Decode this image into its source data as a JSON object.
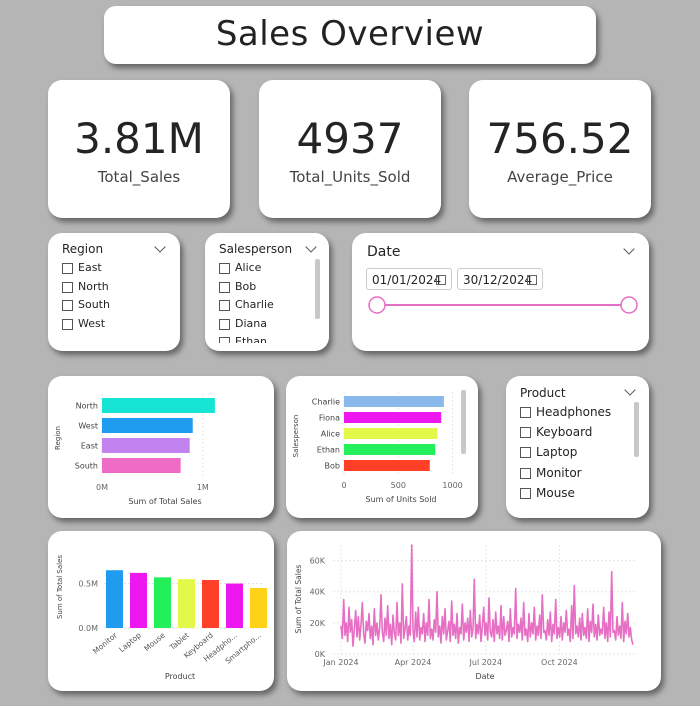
{
  "title": "Sales Overview",
  "kpis": [
    {
      "value": "3.81M",
      "label": "Total_Sales"
    },
    {
      "value": "4937",
      "label": "Total_Units_Sold"
    },
    {
      "value": "756.52",
      "label": "Average_Price"
    }
  ],
  "region_slicer": {
    "title": "Region",
    "items": [
      "East",
      "North",
      "South",
      "West"
    ]
  },
  "salesperson_slicer": {
    "title": "Salesperson",
    "items": [
      "Alice",
      "Bob",
      "Charlie",
      "Diana",
      "Ethan"
    ]
  },
  "date_slicer": {
    "title": "Date",
    "start": "01/01/2024",
    "end": "30/12/2024"
  },
  "product_slicer": {
    "title": "Product",
    "items": [
      "Headphones",
      "Keyboard",
      "Laptop",
      "Monitor",
      "Mouse"
    ]
  },
  "colors": {
    "background": "#b5b5b5",
    "slider": "#e66ec3"
  },
  "chart_data": [
    {
      "type": "bar",
      "orientation": "horizontal",
      "categories": [
        "North",
        "West",
        "East",
        "South"
      ],
      "values": [
        1.12,
        0.9,
        0.87,
        0.78
      ],
      "units": "M",
      "colors": [
        "#16e5d6",
        "#1f9bf0",
        "#c383ef",
        "#ee6cc5"
      ],
      "xlabel": "Sum of Total Sales",
      "ylabel": "Region",
      "xticks": [
        "0M",
        "1M"
      ],
      "xlim": [
        0,
        1.25
      ]
    },
    {
      "type": "bar",
      "orientation": "horizontal",
      "categories": [
        "Charlie",
        "Fiona",
        "Alice",
        "Ethan",
        "Bob"
      ],
      "values": [
        920,
        895,
        860,
        840,
        790
      ],
      "colors": [
        "#8ab8ea",
        "#ee17ef",
        "#e4f84a",
        "#23ef5a",
        "#ff4027"
      ],
      "xlabel": "Sum of Units Sold",
      "ylabel": "Salesperson",
      "xticks": [
        "0",
        "500",
        "1000"
      ],
      "xlim": [
        0,
        1050
      ]
    },
    {
      "type": "bar",
      "orientation": "vertical",
      "categories": [
        "Monitor",
        "Laptop",
        "Mouse",
        "Tablet",
        "Keyboard",
        "Headpho...",
        "Smartpho..."
      ],
      "values": [
        0.65,
        0.62,
        0.57,
        0.55,
        0.54,
        0.5,
        0.45
      ],
      "units": "M",
      "colors": [
        "#1f9bf0",
        "#ee17ef",
        "#23ef5a",
        "#e4f84a",
        "#ff4027",
        "#ee17ef",
        "#ffd21a"
      ],
      "xlabel": "Product",
      "ylabel": "Sum of Total Sales",
      "yticks": [
        "0.0M",
        "0.5M"
      ],
      "ylim": [
        0,
        0.72
      ]
    },
    {
      "type": "line",
      "color": "#e66ec3",
      "xlabel": "Date",
      "ylabel": "Sum of Total Sales",
      "xticks": [
        "Jan 2024",
        "Apr 2024",
        "Jul 2024",
        "Oct 2024"
      ],
      "yticks": [
        "0K",
        "20K",
        "40K",
        "60K"
      ],
      "ylim": [
        0,
        70
      ],
      "units": "K",
      "values": [
        18,
        10,
        35,
        12,
        20,
        8,
        30,
        14,
        22,
        5,
        16,
        28,
        11,
        24,
        9,
        19,
        33,
        13,
        7,
        21,
        15,
        26,
        10,
        18,
        6,
        29,
        12,
        20,
        9,
        17,
        38,
        14,
        8,
        23,
        12,
        31,
        10,
        19,
        6,
        25,
        14,
        9,
        33,
        12,
        20,
        7,
        45,
        10,
        16,
        24,
        9,
        18,
        12,
        70,
        15,
        8,
        27,
        11,
        30,
        9,
        17,
        13,
        26,
        8,
        20,
        12,
        35,
        10,
        16,
        9,
        22,
        14,
        40,
        11,
        18,
        7,
        24,
        13,
        29,
        9,
        15,
        21,
        8,
        34,
        12,
        19,
        10,
        26,
        7,
        17,
        13,
        32,
        9,
        20,
        14,
        23,
        8,
        28,
        11,
        16,
        48,
        10,
        19,
        13,
        25,
        8,
        17,
        30,
        12,
        20,
        9,
        36,
        14,
        11,
        22,
        8,
        27,
        13,
        18,
        10,
        31,
        9,
        24,
        12,
        15,
        21,
        8,
        29,
        11,
        17,
        13,
        42,
        10,
        19,
        14,
        23,
        9,
        33,
        12,
        16,
        8,
        26,
        11,
        20,
        13,
        30,
        9,
        18,
        12,
        25,
        10,
        38,
        14,
        15,
        9,
        22,
        12,
        27,
        8,
        19,
        13,
        35,
        10,
        17,
        11,
        24,
        9,
        20,
        14,
        28,
        12,
        16,
        8,
        31,
        10,
        44,
        13,
        18,
        11,
        23,
        9,
        26,
        12,
        17,
        10,
        29,
        8,
        21,
        14,
        32,
        11,
        19,
        9,
        25,
        12,
        16,
        13,
        30,
        10,
        20,
        8,
        27,
        11,
        53,
        14,
        15,
        9,
        24,
        12,
        18,
        10,
        33,
        8,
        21,
        13,
        26,
        11,
        17,
        9,
        6
      ]
    }
  ]
}
